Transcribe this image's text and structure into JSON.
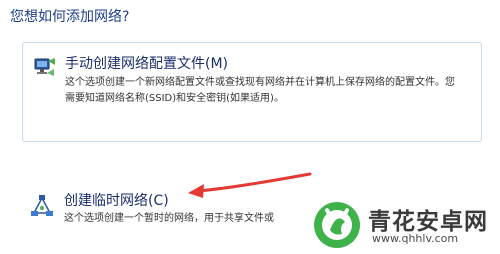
{
  "heading": "您想如何添加网络?",
  "options": [
    {
      "title": "手动创建网络配置文件(M)",
      "description": "这个选项创建一个新网络配置文件或查找现有网络并在计算机上保存网络的配置文件。您需要知道网络名称(SSID)和安全密钥(如果适用)。",
      "icon": "network-adapter-icon"
    },
    {
      "title": "创建临时网络(C)",
      "description": "这个选项创建一个暂时的网络，用于共享文件或",
      "icon": "ad-hoc-network-icon"
    }
  ],
  "annotation": {
    "arrow_color": "#e53935"
  },
  "watermark": {
    "site_name": "青花安卓网",
    "url": "www.qhhlv.com",
    "logo_color": "#3fb24a"
  }
}
